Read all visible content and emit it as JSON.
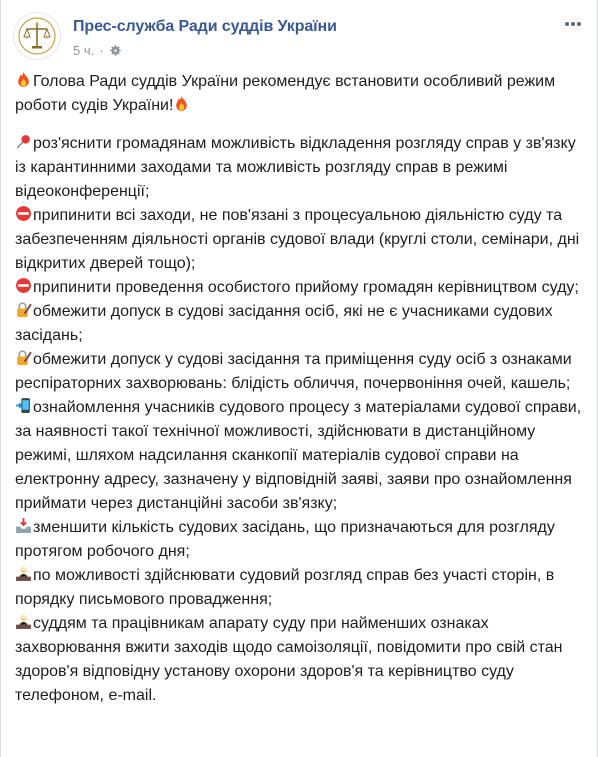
{
  "post": {
    "page_name": "Прес-служба Ради суддів України",
    "time": "5 ч.",
    "dot": "·",
    "headline": "Голова Ради суддів України рекомендує встановити особливий режим роботи судів України!",
    "items": [
      {
        "icon": "pushpin-icon",
        "text": "роз'яснити громадянам можливість відкладення розгляду справ у зв'язку із карантинними заходами та можливість розгляду справ в режимі відеоконференції;"
      },
      {
        "icon": "no-entry-icon",
        "text": "припинити всі заходи, не пов'язані з процесуальною діяльністю суду та забезпеченням діяльності органів судової влади (круглі столи, семінари, дні відкритих дверей тощо);"
      },
      {
        "icon": "no-entry-icon",
        "text": "припинити проведення особистого прийому громадян керівництвом суду;"
      },
      {
        "icon": "lock-with-pen-icon",
        "text": "обмежити допуск в судові засідання осіб, які не є учасниками судових засідань;"
      },
      {
        "icon": "lock-with-pen-icon",
        "text": "обмежити допуск у судові засідання та приміщення суду осіб з ознаками респіраторних захворювань: блідість обличчя, почервоніння очей, кашель;"
      },
      {
        "icon": "mobile-arrow-icon",
        "text": "ознайомлення учасників судового процесу з матеріалами судової справи, за наявності такої технічної можливості, здійснювати в дистанційному режимі, шляхом надсилання сканкопії матеріалів судової справи на електронну адресу, зазначену у відповідній заяві, заяви про ознайомлення приймати через дистанційні засоби зв'язку;"
      },
      {
        "icon": "inbox-tray-icon",
        "text": "зменшити кількість судових засідань, що призначаються для розгляду протягом робочого дня;"
      },
      {
        "icon": "judge-icon",
        "text": "по можливості здійснювати судовий розгляд справ без участі сторін, в порядку письмового провадження;"
      },
      {
        "icon": "judge-icon",
        "text": "суддям та працівникам апарату суду при найменших ознаках захворювання вжити заходів щодо самоізоляції, повідомити про свій стан здоров'я відповідну установу охорони здоров'я та керівництво суду телефоном, e-mail."
      }
    ]
  },
  "icons": {
    "fire": "fire-icon",
    "privacy": "gear-icon",
    "more": "more-options-icon",
    "avatar": "scales-of-justice-logo"
  },
  "colors": {
    "link": "#385898",
    "meta": "#90949c",
    "text": "#1c1e21"
  }
}
